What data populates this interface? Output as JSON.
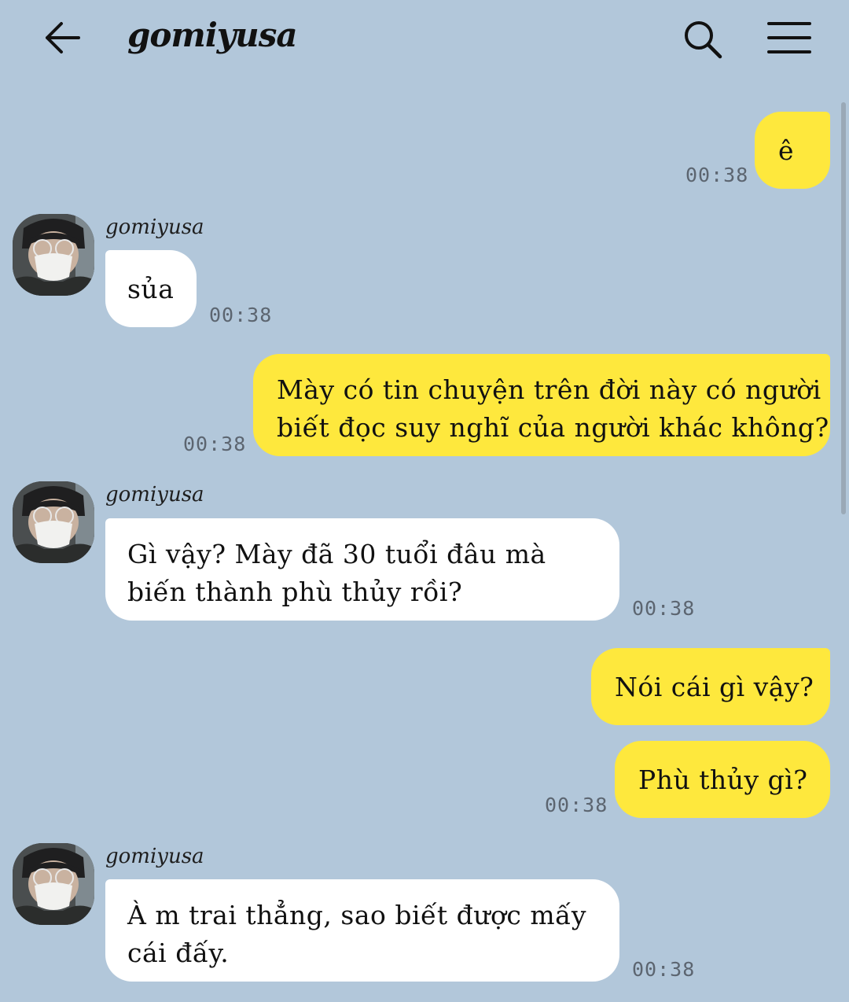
{
  "header": {
    "title": "gomiyusa",
    "back_icon": "back-arrow-icon",
    "search_icon": "search-icon",
    "menu_icon": "menu-icon"
  },
  "colors": {
    "background": "#b2c7da",
    "my_bubble": "#fee83d",
    "their_bubble": "#ffffff"
  },
  "messages": [
    {
      "from": "me",
      "lines": [
        "ê"
      ],
      "time": "00:38"
    },
    {
      "from": "gomiyusa",
      "sender": "gomiyusa",
      "lines": [
        "sủa"
      ],
      "time": "00:38"
    },
    {
      "from": "me",
      "lines": [
        "Mày có tin chuyện trên đời này có người",
        "biết đọc suy nghĩ của người khác không?"
      ],
      "time": "00:38"
    },
    {
      "from": "gomiyusa",
      "sender": "gomiyusa",
      "lines": [
        "Gì vậy? Mày đã 30 tuổi đâu mà",
        "biến thành phù thủy rồi?"
      ],
      "time": "00:38"
    },
    {
      "from": "me",
      "lines": [
        "Nói cái gì vậy?"
      ]
    },
    {
      "from": "me",
      "lines": [
        "Phù thủy gì?"
      ],
      "time": "00:38"
    },
    {
      "from": "gomiyusa",
      "sender": "gomiyusa",
      "lines": [
        "À m trai thẳng, sao biết được mấy",
        "cái đấy."
      ],
      "time": "00:38"
    }
  ]
}
